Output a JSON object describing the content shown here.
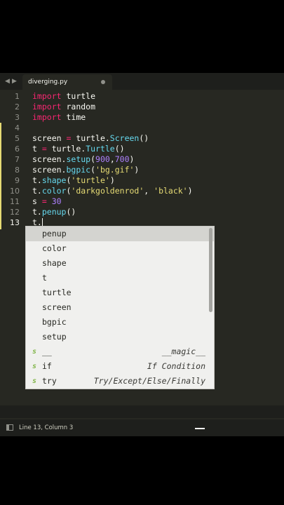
{
  "tab": {
    "filename": "diverging.py"
  },
  "line_numbers": [
    "1",
    "2",
    "3",
    "4",
    "5",
    "6",
    "7",
    "8",
    "9",
    "10",
    "11",
    "12",
    "13"
  ],
  "code": {
    "l1": {
      "kw": "import",
      "rest": " turtle"
    },
    "l2": {
      "kw": "import",
      "rest": " random"
    },
    "l3": {
      "kw": "import",
      "rest": " time"
    },
    "l5": {
      "a": "screen ",
      "op": "=",
      "b": " turtle.",
      "cls": "Screen",
      "c": "()"
    },
    "l6": {
      "a": "t ",
      "op": "=",
      "b": " turtle.",
      "cls": "Turtle",
      "c": "()"
    },
    "l7": {
      "a": "screen.",
      "fn": "setup",
      "b": "(",
      "n1": "900",
      "comma": ",",
      "n2": "700",
      "c": ")"
    },
    "l8": {
      "a": "screen.",
      "fn": "bgpic",
      "b": "(",
      "s": "'bg.gif'",
      "c": ")"
    },
    "l9": {
      "a": "t.",
      "fn": "shape",
      "b": "(",
      "s": "'turtle'",
      "c": ")"
    },
    "l10": {
      "a": "t.",
      "fn": "color",
      "b": "(",
      "s1": "'darkgoldenrod'",
      "sep": ", ",
      "s2": "'black'",
      "c": ")"
    },
    "l11": {
      "a": "s ",
      "op": "=",
      "sp": " ",
      "n": "30"
    },
    "l12": {
      "a": "t.",
      "fn": "penup",
      "c": "()"
    },
    "l13": {
      "a": "t."
    }
  },
  "autocomplete": {
    "items": [
      {
        "label": "penup",
        "hint": "",
        "snippet": false,
        "selected": true
      },
      {
        "label": "color",
        "hint": "",
        "snippet": false
      },
      {
        "label": "shape",
        "hint": "",
        "snippet": false
      },
      {
        "label": "t",
        "hint": "",
        "snippet": false
      },
      {
        "label": "turtle",
        "hint": "",
        "snippet": false
      },
      {
        "label": "screen",
        "hint": "",
        "snippet": false
      },
      {
        "label": "bgpic",
        "hint": "",
        "snippet": false
      },
      {
        "label": "setup",
        "hint": "",
        "snippet": false
      },
      {
        "label": "__",
        "hint": "__magic__",
        "snippet": true
      },
      {
        "label": "if",
        "hint": "If Condition",
        "snippet": true
      },
      {
        "label": "try",
        "hint": "Try/Except/Else/Finally",
        "snippet": true
      }
    ],
    "snippet_badge": "s"
  },
  "status": {
    "position": "Line 13, Column 3"
  },
  "colors": {
    "background": "#272822",
    "keyword": "#f92672",
    "function": "#66d9ef",
    "string": "#e6db74",
    "number": "#ae81ff"
  }
}
